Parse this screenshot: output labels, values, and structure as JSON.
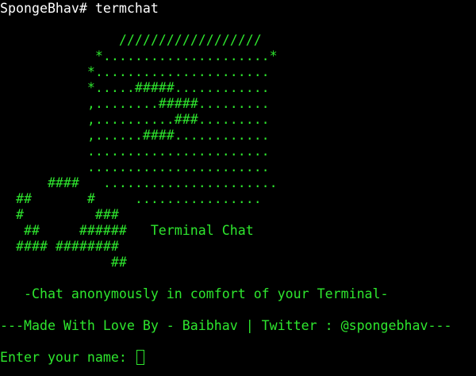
{
  "command_line": {
    "prompt": "SpongeBhav# ",
    "command": "termchat"
  },
  "banner": [
    "               //////////////////",
    "            *.....................*",
    "           *......................",
    "           *.....#####............",
    "           ,........#####.........",
    "           ,..........###.........",
    "           ,......####............",
    "           .......................",
    "           .......................",
    "      ####   ......................",
    "  ##       #     ................",
    "  #         ###",
    "   ##     ######   Terminal Chat",
    "  #### ########",
    "              ##"
  ],
  "tagline": "   -Chat anonymously in comfort of your Terminal-",
  "credits": "---Made With Love By - Baibhav | Twitter : @spongebhav---",
  "name_prompt": {
    "label": "Enter your name: ",
    "value": ""
  },
  "colors": {
    "background": "#000000",
    "text": "#2ee62e",
    "prompt": "#ffffff"
  }
}
